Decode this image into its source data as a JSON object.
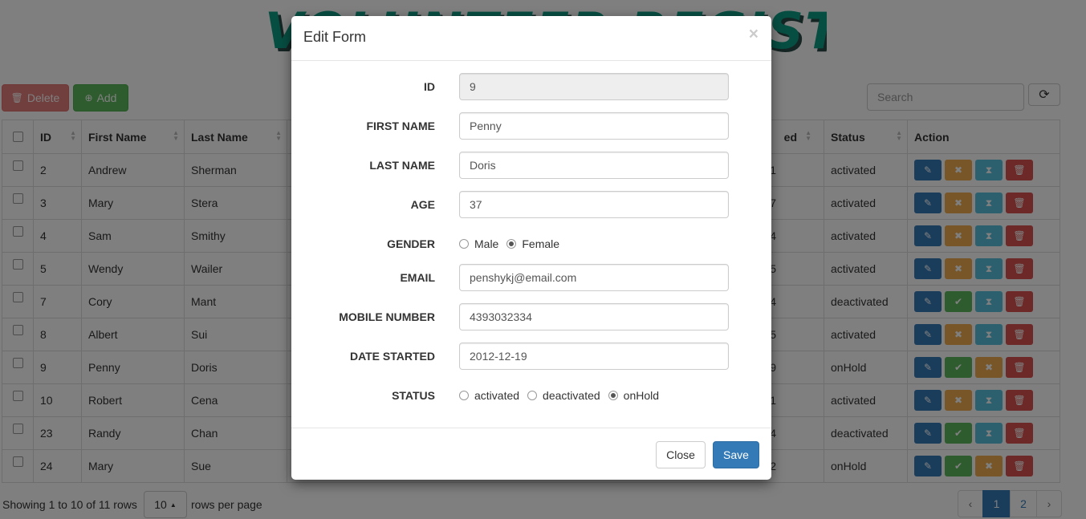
{
  "page": {
    "title": "VOLUNTEER REGISTRY",
    "toolbar": {
      "delete_label": "Delete",
      "add_label": "Add"
    },
    "search": {
      "placeholder": "Search"
    },
    "table": {
      "headers": [
        "ID",
        "First Name",
        "Last Name",
        "ed",
        "Status",
        "Action"
      ],
      "rows": [
        {
          "id": "2",
          "first": "Andrew",
          "last": "Sherman",
          "hidden": "1",
          "status": "activated",
          "actions": [
            "edit-icon",
            "deactivate-icon",
            "hold-icon",
            "trash-icon"
          ]
        },
        {
          "id": "3",
          "first": "Mary",
          "last": "Stera",
          "hidden": "7",
          "status": "activated",
          "actions": [
            "edit-icon",
            "deactivate-icon",
            "hold-icon",
            "trash-icon"
          ]
        },
        {
          "id": "4",
          "first": "Sam",
          "last": "Smithy",
          "hidden": "4",
          "status": "activated",
          "actions": [
            "edit-icon",
            "deactivate-icon",
            "hold-icon",
            "trash-icon"
          ]
        },
        {
          "id": "5",
          "first": "Wendy",
          "last": "Wailer",
          "hidden": "5",
          "status": "activated",
          "actions": [
            "edit-icon",
            "deactivate-icon",
            "hold-icon",
            "trash-icon"
          ]
        },
        {
          "id": "7",
          "first": "Cory",
          "last": "Mant",
          "hidden": "4",
          "status": "deactivated",
          "actions": [
            "edit-icon",
            "activate-icon",
            "hold-icon",
            "trash-icon"
          ]
        },
        {
          "id": "8",
          "first": "Albert",
          "last": "Sui",
          "hidden": "5",
          "status": "activated",
          "actions": [
            "edit-icon",
            "deactivate-icon",
            "hold-icon",
            "trash-icon"
          ]
        },
        {
          "id": "9",
          "first": "Penny",
          "last": "Doris",
          "hidden": "9",
          "status": "onHold",
          "actions": [
            "edit-icon",
            "activate-icon",
            "deactivate-icon",
            "trash-icon"
          ]
        },
        {
          "id": "10",
          "first": "Robert",
          "last": "Cena",
          "hidden": "1",
          "status": "activated",
          "actions": [
            "edit-icon",
            "deactivate-icon",
            "hold-icon",
            "trash-icon"
          ]
        },
        {
          "id": "23",
          "first": "Randy",
          "last": "Chan",
          "hidden": "4",
          "status": "deactivated",
          "actions": [
            "edit-icon",
            "activate-icon",
            "hold-icon",
            "trash-icon"
          ]
        },
        {
          "id": "24",
          "first": "Mary",
          "last": "Sue",
          "hidden": "2",
          "status": "onHold",
          "actions": [
            "edit-icon",
            "activate-icon",
            "deactivate-icon",
            "trash-icon"
          ]
        }
      ]
    },
    "footer": {
      "showing": "Showing 1 to 10 of 11 rows",
      "rows_per_page_value": "10",
      "rows_per_page_label": "rows per page",
      "pager": {
        "prev": "‹",
        "pages": [
          "1",
          "2"
        ],
        "active_page": "1",
        "next": "›"
      }
    }
  },
  "modal": {
    "title": "Edit Form",
    "close_x": "×",
    "fields": {
      "id": {
        "label": "ID",
        "value": "9"
      },
      "first_name": {
        "label": "FIRST NAME",
        "value": "Penny"
      },
      "last_name": {
        "label": "LAST NAME",
        "value": "Doris"
      },
      "age": {
        "label": "AGE",
        "value": "37"
      },
      "gender": {
        "label": "GENDER",
        "options": [
          "Male",
          "Female"
        ],
        "selected": "Female"
      },
      "email": {
        "label": "EMAIL",
        "value": "penshykj@email.com"
      },
      "mobile": {
        "label": "MOBILE NUMBER",
        "value": "4393032334"
      },
      "date_started": {
        "label": "DATE STARTED",
        "value": "2012-12-19"
      },
      "status": {
        "label": "STATUS",
        "options": [
          "activated",
          "deactivated",
          "onHold"
        ],
        "selected": "onHold"
      }
    },
    "buttons": {
      "close": "Close",
      "save": "Save"
    }
  },
  "colors": {
    "primary": "#337ab7",
    "success": "#5cb85c",
    "warning": "#f0ad4e",
    "info": "#5bc0de",
    "danger": "#d9534f",
    "title": "#0e9c84"
  }
}
